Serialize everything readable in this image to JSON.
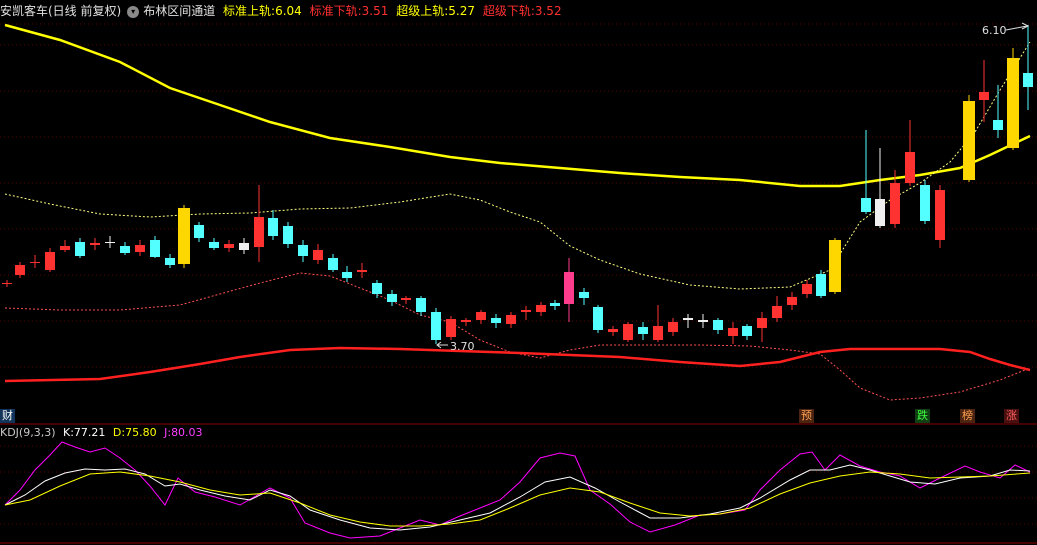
{
  "header": {
    "stock_name": "安凯客车(日线 前复权)",
    "indicator_name": "布林区间通道",
    "std_upper_label": "标准上轨:",
    "std_upper_value": "6.04",
    "std_lower_label": "标准下轨:",
    "std_lower_value": "3.51",
    "super_upper_label": "超级上轨:",
    "super_upper_value": "5.27",
    "super_lower_label": "超级下轨:",
    "super_lower_value": "3.52"
  },
  "annotations": {
    "high_label": "6.10",
    "low_label": "3.70"
  },
  "markers": {
    "cai": "财",
    "yu": "预",
    "die": "跌",
    "bang": "榜",
    "zhang": "涨"
  },
  "kdj": {
    "name": "KDJ(9,3,3)",
    "k_label": "K:",
    "k_value": "77.21",
    "d_label": "D:",
    "d_value": "75.80",
    "j_label": "J:",
    "j_value": "80.03"
  },
  "colors": {
    "up": "#ff3232",
    "down": "#54ffff",
    "highlight": "#ffd700",
    "magenta": "#ff3c8c",
    "yellow_line": "#ffff00",
    "red_line": "#ff2020",
    "kdj_k": "#ffffff",
    "kdj_d": "#ffff00",
    "kdj_j": "#ff00ff"
  }
}
